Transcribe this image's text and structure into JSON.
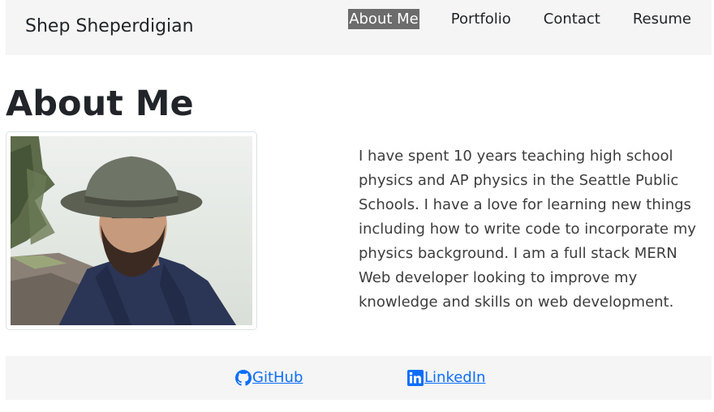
{
  "navbar": {
    "brand": "Shep Sheperdigian",
    "links": [
      {
        "label": "About Me",
        "active": true
      },
      {
        "label": "Portfolio",
        "active": false
      },
      {
        "label": "Contact",
        "active": false
      },
      {
        "label": "Resume",
        "active": false
      }
    ]
  },
  "main": {
    "title": "About Me",
    "photo_icon": "profile-photo",
    "bio": "I have spent 10 years teaching high school physics and AP physics in the Seattle Public Schools. I have a love for learning new things including how to write code to incorporate my physics background. I am a full stack MERN Web developer looking to improve my knowledge and skills on web development."
  },
  "footer": {
    "github": {
      "label": "GitHub",
      "icon": "github-icon"
    },
    "linkedin": {
      "label": "LinkedIn",
      "icon": "linkedin-icon"
    }
  },
  "colors": {
    "nav_bg": "#f5f5f5",
    "active_nav_bg": "#6c6c6c",
    "link": "#0d6efd",
    "text": "#212529"
  }
}
